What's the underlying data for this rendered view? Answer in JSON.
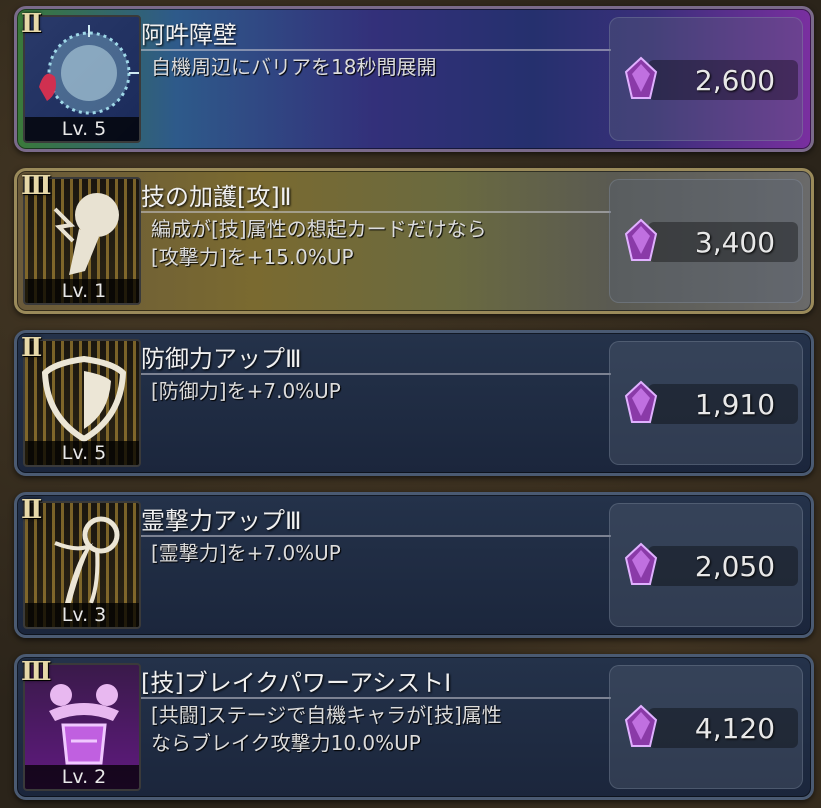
{
  "skills": [
    {
      "rank": "II",
      "title": "阿吽障壁",
      "desc": [
        "自機周辺にバリアを18秒間展開"
      ],
      "level": "Lv. 5",
      "price": "2,600",
      "icon": "barrier-icon"
    },
    {
      "rank": "III",
      "title": "技の加護[攻]Ⅱ",
      "desc": [
        "編成が[技]属性の想起カードだけなら",
        "[攻撃力]を+15.0%UP"
      ],
      "level": "Lv. 1",
      "price": "3,400",
      "icon": "fist-icon"
    },
    {
      "rank": "II",
      "title": "防御力アップⅢ",
      "desc": [
        "[防御力]を+7.0%UP"
      ],
      "level": "Lv. 5",
      "price": "1,910",
      "icon": "shield-icon"
    },
    {
      "rank": "II",
      "title": "霊撃力アップⅢ",
      "desc": [
        "[霊撃力]を+7.0%UP"
      ],
      "level": "Lv. 3",
      "price": "2,050",
      "icon": "spirit-flame-icon"
    },
    {
      "rank": "III",
      "title": "[技]ブレイクパワーアシストⅠ",
      "desc": [
        "[共闘]ステージで自機キャラが[技]属性",
        "ならブレイク攻撃力10.0%UP"
      ],
      "level": "Lv. 2",
      "price": "4,120",
      "icon": "assist-icon"
    }
  ],
  "colors": {
    "gem": "#8a3aa8",
    "rank": "#e6d8a8"
  }
}
